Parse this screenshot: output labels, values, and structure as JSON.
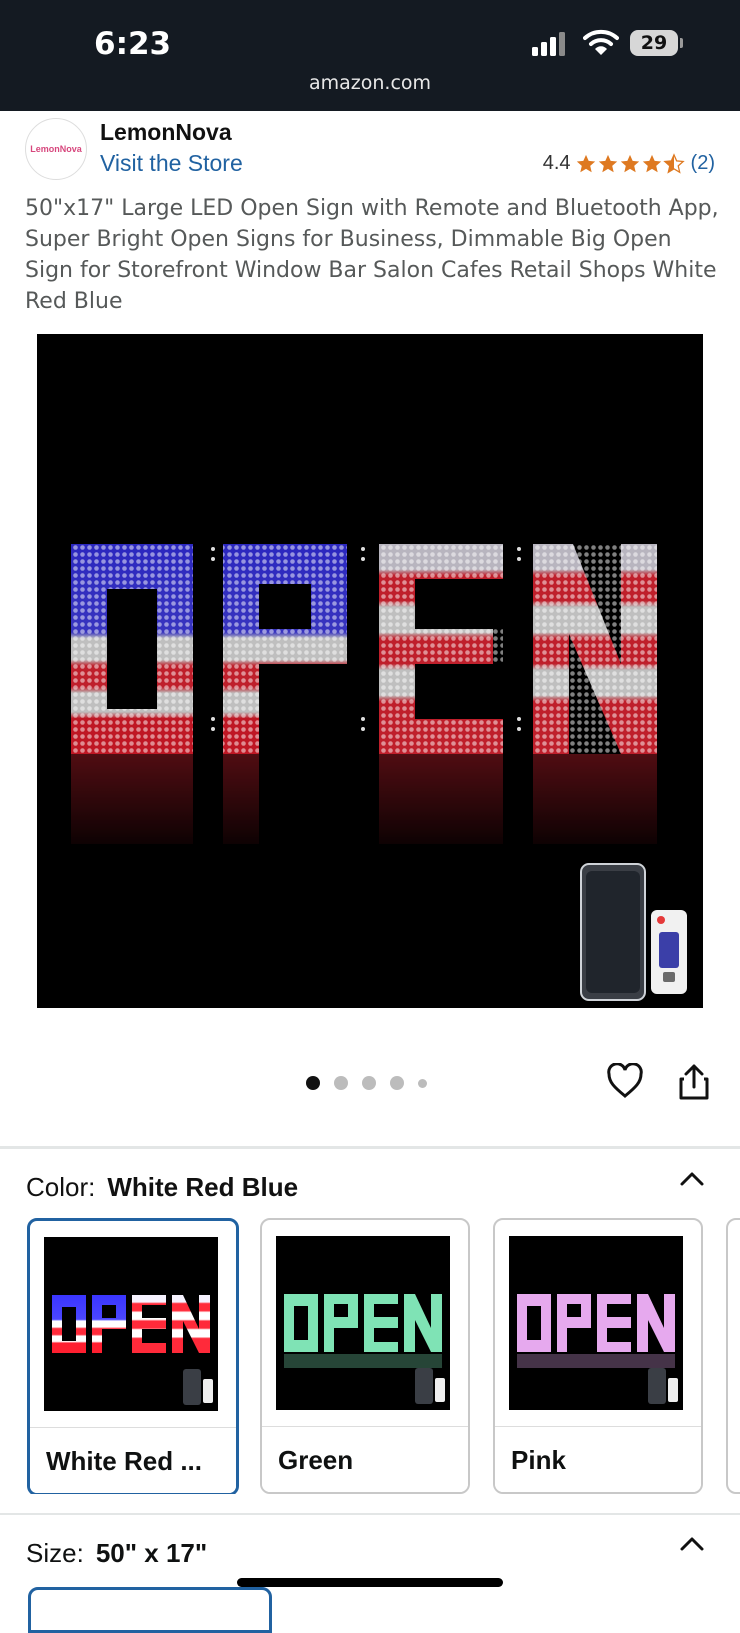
{
  "status": {
    "time": "6:23",
    "url": "amazon.com",
    "battery": "29"
  },
  "brand": {
    "name": "LemonNova",
    "logo_text": "LemonNova",
    "store_link": "Visit the Store"
  },
  "rating": {
    "value": "4.4",
    "count": "(2)",
    "stars": 4.4
  },
  "product_title": "50\"x17\" Large LED Open Sign with Remote and Bluetooth App, Super Bright Open Signs for Business, Dimmable Big Open Sign for Storefront Window Bar Salon Cafes Retail Shops White Red Blue",
  "gallery": {
    "image_count": 5,
    "active_index": 0,
    "hero_text": "OPEN"
  },
  "color_selector": {
    "label": "Color:",
    "selected": "White Red Blue",
    "options": [
      {
        "label": "White Red ...",
        "sign_text": "OPEN",
        "style": "flag"
      },
      {
        "label": "Green",
        "sign_text": "OPEN",
        "style": "green"
      },
      {
        "label": "Pink",
        "sign_text": "OPEN",
        "style": "pink"
      }
    ]
  },
  "size_selector": {
    "label": "Size:",
    "selected": "50\" x 17\""
  },
  "colors": {
    "link": "#2162a1",
    "star": "#de7921",
    "status_bar": "#141a22",
    "green_led": "#7fe3b5",
    "pink_led": "#e6a9ee"
  }
}
